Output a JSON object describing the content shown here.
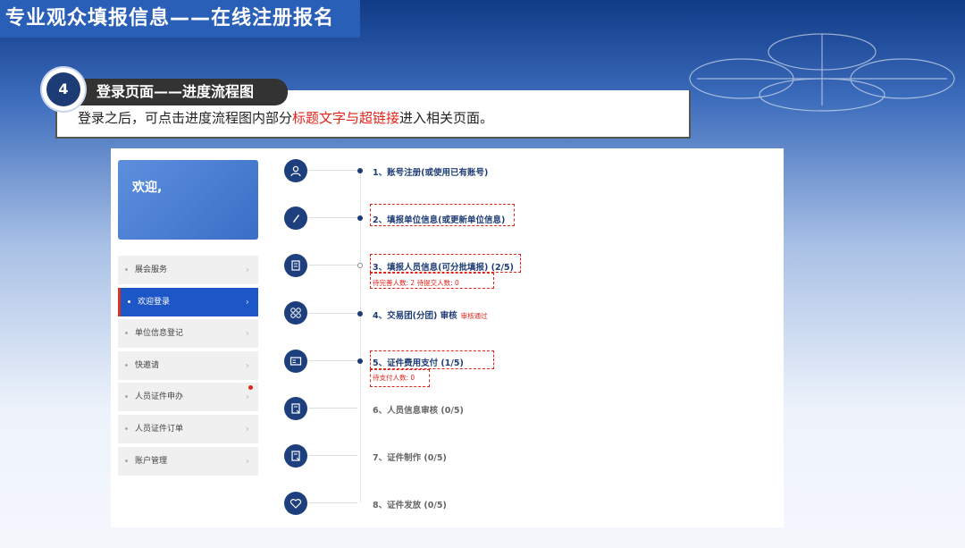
{
  "header": {
    "title": "专业观众填报信息——在线注册报名"
  },
  "step": {
    "number": "4",
    "title": "登录页面——进度流程图",
    "desc_before": "登录之后，可点击进度流程图内部分",
    "desc_highlight": "标题文字与超链接",
    "desc_after": "进入相关页面。"
  },
  "welcome": {
    "text": "欢迎,"
  },
  "menu": {
    "items": [
      {
        "label": "展会服务"
      },
      {
        "label": "欢迎登录"
      },
      {
        "label": "单位信息登记"
      },
      {
        "label": "快邀请"
      },
      {
        "label": "人员证件申办"
      },
      {
        "label": "人员证件订单"
      },
      {
        "label": "账户管理"
      }
    ],
    "arrow": "›"
  },
  "steps": [
    {
      "label": "1、账号注册(或使用已有账号)",
      "icon": "user-icon"
    },
    {
      "label": "2、填报单位信息(或更新单位信息)",
      "icon": "pencil-icon"
    },
    {
      "label": "3、填报人员信息(可分批填报) (2/5)",
      "icon": "document-icon",
      "sub": "待完善人数: 2    待提交人数: 0"
    },
    {
      "label": "4、交易团(分团) 审核",
      "icon": "grid-icon",
      "badge": "审核通过"
    },
    {
      "label": "5、证件费用支付 (1/5)",
      "icon": "card-icon",
      "sub": "待支付人数: 0"
    },
    {
      "label": "6、人员信息审核 (0/5)",
      "icon": "document-edit-icon"
    },
    {
      "label": "7、证件制作 (0/5)",
      "icon": "document-edit-icon"
    },
    {
      "label": "8、证件发放 (0/5)",
      "icon": "heart-icon"
    }
  ],
  "colors": {
    "accent": "#1d3b74",
    "highlight": "#e2231a",
    "active_menu": "#1d56c6"
  }
}
